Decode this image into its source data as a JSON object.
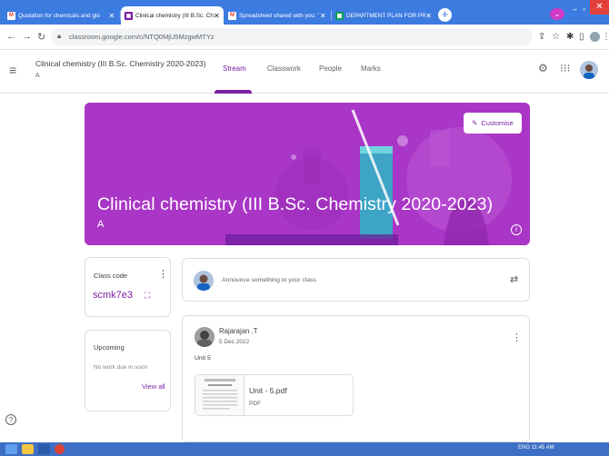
{
  "browser": {
    "tabs": [
      {
        "title": "Quotation for chemicals and glo",
        "icon": "gmail-icon",
        "active": false
      },
      {
        "title": "Clinical chemistry (III B.Sc. Chem",
        "icon": "classroom-icon",
        "active": true
      },
      {
        "title": "Spreadsheet shared with you: \"C",
        "icon": "gmail-icon",
        "active": false
      },
      {
        "title": "DEPARTMENT PLAN FOR PRESE",
        "icon": "sheets-icon",
        "active": false
      }
    ],
    "url": "classroom.google.com/c/NTQ0MjU5MzgwMTYz",
    "colors": {
      "tabstrip": "#3c7be0",
      "close": "#e2413b"
    }
  },
  "header": {
    "class_title": "Clinical chemistry (III B.Sc. Chemistry 2020-2023)",
    "class_section": "A",
    "tabs": [
      "Stream",
      "Classwork",
      "People",
      "Marks"
    ],
    "active_tab": "Stream",
    "accent": "#7b1fa2"
  },
  "banner": {
    "title": "Clinical chemistry (III B.Sc. Chemistry 2020-2023)",
    "section": "A",
    "customise_label": "Customise",
    "color": "#a936c6"
  },
  "class_code": {
    "label": "Class code",
    "value": "scmk7e3"
  },
  "upcoming": {
    "label": "Upcoming",
    "empty_text": "No work due in soon",
    "view_all": "View all"
  },
  "announce": {
    "placeholder": "Announce something to your class"
  },
  "post": {
    "author": "Rajarajan .T",
    "date": "5 Dec 2022",
    "text": "Unit 5",
    "attachment": {
      "name": "Unit - 5.pdf",
      "type": "PDF"
    }
  },
  "taskbar": {
    "tray": "ENG  11:45 AM"
  }
}
